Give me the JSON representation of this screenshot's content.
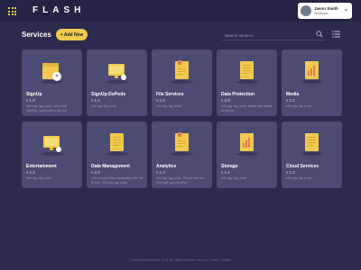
{
  "header": {
    "logo": "FLASH",
    "user": {
      "name": "Jason Smith",
      "role": "Developer"
    }
  },
  "toolbar": {
    "title": "Services",
    "add_label": "+ Add New",
    "search_placeholder": "Search services"
  },
  "cards": [
    {
      "name": "SignUp",
      "version": "v 1.0",
      "desc": "Info tag, tag, pods, auth-mail, building, optimization api test",
      "icon": "signup-icon"
    },
    {
      "name": "SignUp-DoPods",
      "version": "v 1.4",
      "desc": "Info tag, tag, pods",
      "icon": "monitor-icon"
    },
    {
      "name": "File Services",
      "version": "v 1.0",
      "desc": "Info tag, tag, pods",
      "icon": "file-icon"
    },
    {
      "name": "Data Protection",
      "version": "v 2.0",
      "desc": "Info tag, tag, pods. Make data driven decisions",
      "icon": "document-icon"
    },
    {
      "name": "Media",
      "version": "v 2.1",
      "desc": "Info tag, tag, pods",
      "icon": "chart-doc-icon"
    },
    {
      "name": "Entertainment",
      "version": "v 2.2",
      "desc": "Info tag, tag, pods",
      "icon": "monitor-icon"
    },
    {
      "name": "Data Management",
      "version": "v 2.3",
      "desc": "Get a competitive advantage with the BI tool. Info tag, tag, pods",
      "icon": "document-icon"
    },
    {
      "name": "Analytics",
      "version": "v 1.3",
      "desc": "Info tag, tag, pods. Reach fast and leverage opportunities",
      "icon": "file-icon"
    },
    {
      "name": "Storage",
      "version": "v 1.6",
      "desc": "Info tag, tag, pods",
      "icon": "chart-doc-icon"
    },
    {
      "name": "Cloud Services",
      "version": "v 2.3",
      "desc": "Info tag, tag, pods",
      "icon": "document-icon"
    }
  ],
  "footer": {
    "text": "© basecamp-services 2018. All rights reserved. Privacy | Press | Contact"
  },
  "colors": {
    "background": "#2b2b4d",
    "header": "#232343",
    "card": "#4b4b73",
    "accent": "#f2c94c"
  }
}
